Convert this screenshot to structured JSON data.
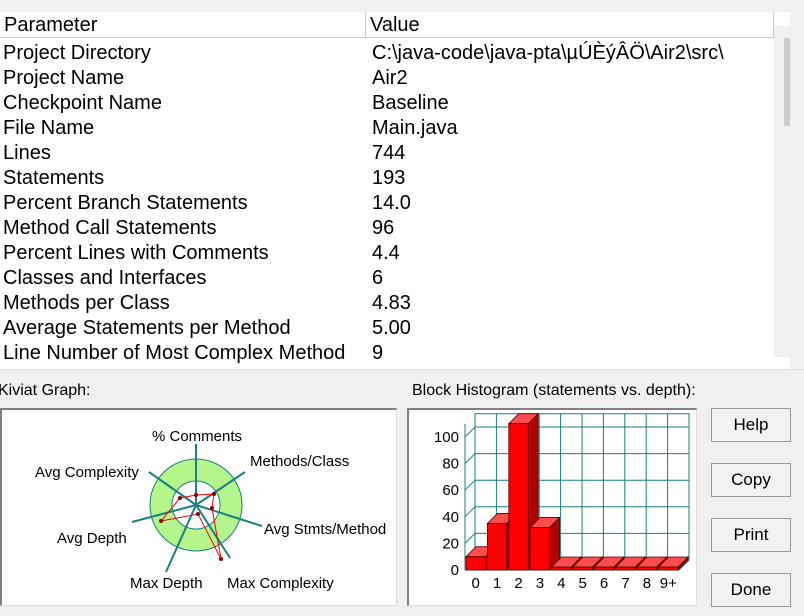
{
  "table": {
    "headers": {
      "parameter": "Parameter",
      "value": "Value"
    },
    "rows": [
      {
        "parameter": "Project Directory",
        "value": "C:\\java-code\\java-pta\\µÚÈýÂÖ\\Air2\\src\\"
      },
      {
        "parameter": "Project Name",
        "value": "Air2"
      },
      {
        "parameter": "Checkpoint Name",
        "value": "Baseline"
      },
      {
        "parameter": "File Name",
        "value": "Main.java"
      },
      {
        "parameter": "Lines",
        "value": "744"
      },
      {
        "parameter": "Statements",
        "value": "193"
      },
      {
        "parameter": "Percent Branch Statements",
        "value": "14.0"
      },
      {
        "parameter": "Method Call Statements",
        "value": "96"
      },
      {
        "parameter": "Percent Lines with Comments",
        "value": "4.4"
      },
      {
        "parameter": "Classes and Interfaces",
        "value": "6"
      },
      {
        "parameter": "Methods per Class",
        "value": "4.83"
      },
      {
        "parameter": "Average Statements per Method",
        "value": "5.00"
      },
      {
        "parameter": "Line Number of Most Complex Method",
        "value": "9"
      }
    ]
  },
  "kiviat": {
    "title": "Kiviat Graph:",
    "axes": {
      "comments": "% Comments",
      "methods_class": "Methods/Class",
      "avg_stmts": "Avg Stmts/Method",
      "max_complexity": "Max Complexity",
      "max_depth": "Max Depth",
      "avg_depth": "Avg Depth",
      "avg_complexity": "Avg Complexity"
    },
    "colors": {
      "outer_ring": "#b4f58c",
      "inner_circle": "#ffffff",
      "spokes": "#1a7f7f",
      "polygon": "#ff0000"
    }
  },
  "histogram": {
    "title": "Block Histogram (statements vs. depth):",
    "colors": {
      "bar": "#ff0000",
      "grid": "#1a7f7f"
    }
  },
  "chart_data": {
    "type": "bar",
    "title": "Block Histogram (statements vs. depth):",
    "categories": [
      "0",
      "1",
      "2",
      "3",
      "4",
      "5",
      "6",
      "7",
      "8",
      "9+"
    ],
    "values": [
      10,
      35,
      110,
      32,
      0,
      0,
      0,
      0,
      0,
      0
    ],
    "ylim": [
      0,
      110
    ],
    "yticks": [
      "0",
      "20",
      "40",
      "60",
      "80",
      "100"
    ],
    "grid": true
  },
  "buttons": {
    "help": "Help",
    "copy": "Copy",
    "print": "Print",
    "done": "Done"
  }
}
